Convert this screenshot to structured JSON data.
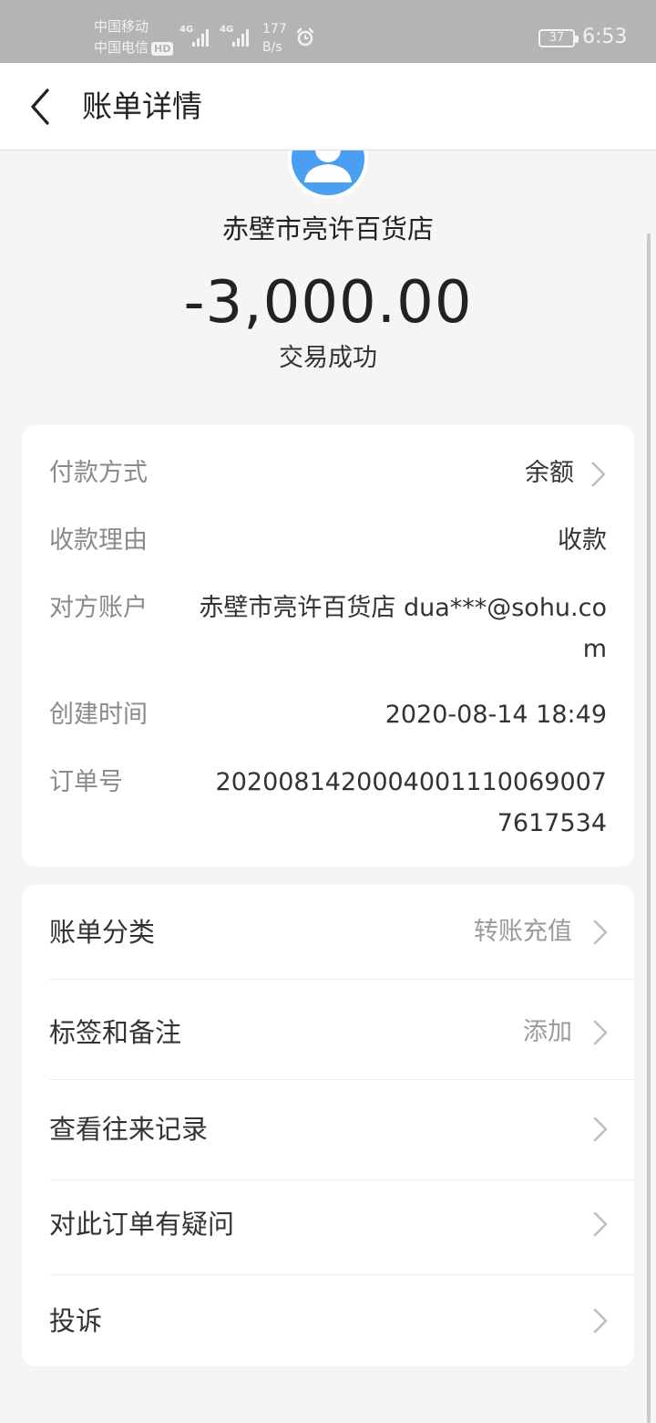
{
  "status_bar": {
    "carrier1": "中国移动",
    "carrier2": "中国电信",
    "hd": "HD",
    "sig1_label": "4G",
    "sig2_label": "4G",
    "net_speed_value": "177",
    "net_speed_unit": "B/s",
    "battery": "37",
    "time": "6:53"
  },
  "nav": {
    "title": "账单详情"
  },
  "header": {
    "merchant": "赤壁市亮许百货店",
    "amount": "-3,000.00",
    "status": "交易成功"
  },
  "details": {
    "payment_method_label": "付款方式",
    "payment_method_value": "余额",
    "reason_label": "收款理由",
    "reason_value": "收款",
    "counterparty_label": "对方账户",
    "counterparty_value": "赤壁市亮许百货店 dua***@sohu.com",
    "created_label": "创建时间",
    "created_value": "2020-08-14 18:49",
    "order_label": "订单号",
    "order_value": "20200814200040011100690077617534"
  },
  "actions": {
    "category_label": "账单分类",
    "category_value": "转账充值",
    "tags_label": "标签和备注",
    "tags_value": "添加",
    "history_label": "查看往来记录",
    "question_label": "对此订单有疑问",
    "complaint_label": "投诉"
  }
}
